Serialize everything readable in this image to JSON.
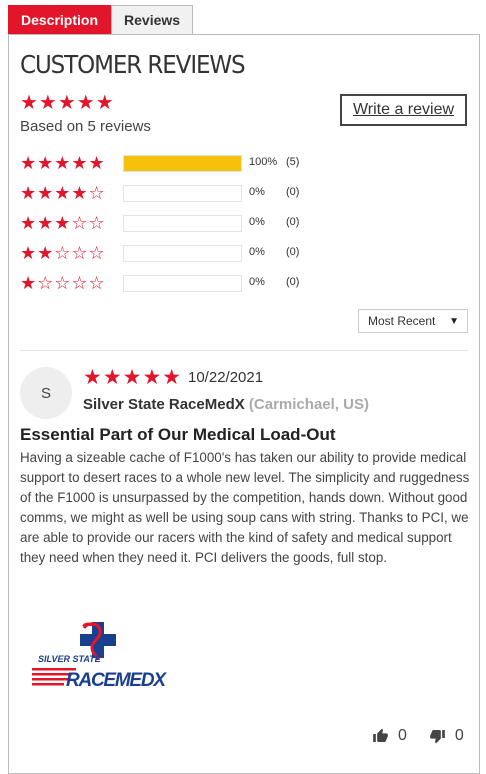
{
  "tabs": [
    {
      "label": "Description",
      "active": true
    },
    {
      "label": "Reviews",
      "active": false
    }
  ],
  "section_title": "CUSTOMER REVIEWS",
  "summary": {
    "rating": 5,
    "stars": "★★★★★",
    "based_on": "Based on 5 reviews",
    "write_review_label": "Write a review"
  },
  "histogram": [
    {
      "stars": "★★★★★",
      "rating": 5,
      "percent_value": 100,
      "percent": "100%",
      "count": "(5)"
    },
    {
      "stars": "★★★★☆",
      "rating": 4,
      "percent_value": 0,
      "percent": "0%",
      "count": "(0)"
    },
    {
      "stars": "★★★☆☆",
      "rating": 3,
      "percent_value": 0,
      "percent": "0%",
      "count": "(0)"
    },
    {
      "stars": "★★☆☆☆",
      "rating": 2,
      "percent_value": 0,
      "percent": "0%",
      "count": "(0)"
    },
    {
      "stars": "★☆☆☆☆",
      "rating": 1,
      "percent_value": 0,
      "percent": "0%",
      "count": "(0)"
    }
  ],
  "sort": {
    "selected": "Most Recent"
  },
  "review": {
    "avatar_initial": "S",
    "rating": 5,
    "stars": "★★★★★",
    "date": "10/22/2021",
    "author": "Silver State RaceMedX",
    "location": "(Carmichael, US)",
    "title": "Essential Part of Our Medical Load-Out",
    "body": "Having a sizeable cache of F1000's has taken our ability to provide medical support to desert races to a whole new level. The simplicity and ruggedness of the F1000 is unsurpassed by the competition, hands down. Without good comms, we might as well be using soup cans with string. Thanks to PCI, we are able to provide our racers with the kind of safety and medical support they need when they need it. PCI delivers the goods, full stop.",
    "thumbs_up_count": "0",
    "thumbs_down_count": "0"
  },
  "logo": {
    "line1": "SILVER STATE",
    "line2": "RACEMEDX"
  },
  "colors": {
    "accent": "#e3152b",
    "bar_fill": "#f4c20d",
    "logo_blue": "#1b3f8f"
  },
  "icons": [
    "thumbs-up-icon",
    "thumbs-down-icon",
    "caret-down-icon",
    "star-icon"
  ]
}
